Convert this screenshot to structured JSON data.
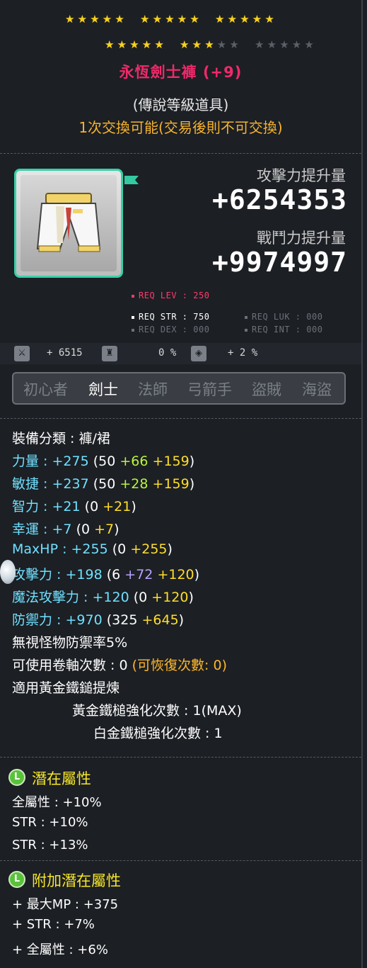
{
  "stars": {
    "row1": [
      1,
      1,
      1,
      1,
      1,
      1,
      1,
      1,
      1,
      1,
      1,
      1,
      1,
      1,
      1
    ],
    "row2": [
      1,
      1,
      1,
      1,
      1,
      1,
      1,
      1,
      0,
      0,
      0,
      0,
      0,
      0,
      0
    ]
  },
  "item": {
    "name": "永恆劍士褲 (+9)",
    "grade": "(傳說等級道具)",
    "trade": "1次交換可能(交易後則不可交換)",
    "attack_gain_label": "攻擊力提升量",
    "attack_gain_value": "+6254353",
    "combat_gain_label": "戰鬥力提升量",
    "combat_gain_value": "+9974997",
    "icon": "white-pants-icon"
  },
  "requirements": {
    "lev": "REQ LEV : 250",
    "str": "REQ STR : 750",
    "luk": "REQ LUK : 000",
    "dex": "REQ DEX : 000",
    "int": "REQ INT : 000"
  },
  "icon_stats": {
    "first": "+ 6515",
    "second": "0 %",
    "third": "+ 2 %"
  },
  "jobs": [
    "初心者",
    "劍士",
    "法師",
    "弓箭手",
    "盜賊",
    "海盜"
  ],
  "active_job_index": 1,
  "stats": {
    "category": "裝備分類 : 褲/裙",
    "str": {
      "label": "力量 :",
      "total": "+275",
      "open": "(50",
      "a": "+66",
      "b": "+159",
      "close": ")"
    },
    "dex": {
      "label": "敏捷 :",
      "total": "+237",
      "open": "(50",
      "a": "+28",
      "b": "+159",
      "close": ")"
    },
    "int": {
      "label": "智力 :",
      "total": "+21",
      "open": "(0",
      "b": "+21",
      "close": ")"
    },
    "luk": {
      "label": "幸運 :",
      "total": "+7",
      "open": "(0",
      "b": "+7",
      "close": ")"
    },
    "maxhp": {
      "label": "MaxHP :",
      "total": "+255",
      "open": "(0",
      "b": "+255",
      "close": ")"
    },
    "att": {
      "label": "攻擊力 :",
      "total": "+198",
      "open": "(6",
      "a": "+72",
      "b": "+120",
      "close": ")"
    },
    "matt": {
      "label": "魔法攻擊力 :",
      "total": "+120",
      "open": "(0",
      "b": "+120",
      "close": ")"
    },
    "def": {
      "label": "防禦力 :",
      "total": "+970",
      "open": "(325",
      "b": "+645",
      "close": ")"
    },
    "ignore_def": "無視怪物防禦率5%",
    "scrolls": "可使用卷軸次數 : 0",
    "scrolls_recover": "(可恢復次數: 0)",
    "hammer": "適用黃金鐵鎚提煉",
    "gold_hammer": "黃金鐵槌強化次數 : 1(MAX)",
    "plat_hammer": "白金鐵槌強化次數 : 1"
  },
  "potential": {
    "icon_letter": "L",
    "title": "潛在屬性",
    "lines": [
      "全屬性 : +10%",
      "STR : +10%",
      "STR : +13%"
    ]
  },
  "bonus_potential": {
    "icon_letter": "L",
    "title": "附加潛在屬性",
    "lines": [
      "+ 最大MP : +375",
      "+ STR : +7%",
      "+ 全屬性 : +6%"
    ]
  },
  "colors": {
    "title": "#ee2a6a",
    "trade": "#f5b330",
    "stat_label": "#6fe0ff",
    "base_bonus": "#b8f53a",
    "enhance_bonus": "#ffde2a",
    "scroll_bonus": "#b9a2ff",
    "section_title": "#f6e62a"
  }
}
